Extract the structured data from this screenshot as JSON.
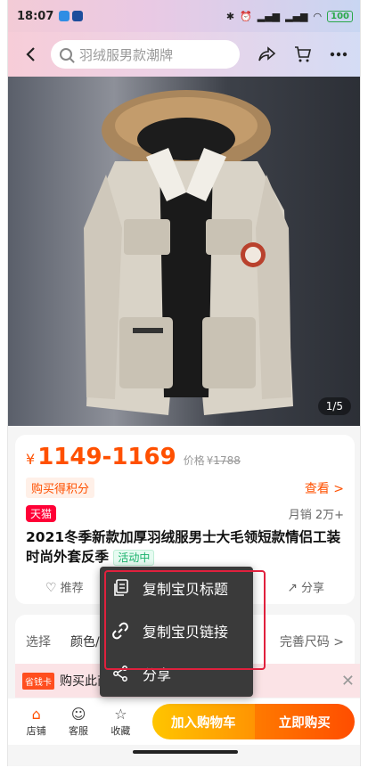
{
  "status_bar": {
    "time": "18:07",
    "battery": "100"
  },
  "nav": {
    "search_placeholder": "羽绒服男款潮牌"
  },
  "gallery": {
    "pager": "1/5"
  },
  "price": {
    "currency": "¥",
    "range": "1149-1169",
    "orig_label": "价格",
    "orig_currency": "¥",
    "orig_value": "1788"
  },
  "points_tag": "购买得积分",
  "see_link": "查看 >",
  "store_tag": "天猫",
  "sales": "月销 2万+",
  "product_title": "2021冬季新款加厚羽绒服男士大毛领短款情侣工装时尚外套反季",
  "active_tag": "活动中",
  "actions": {
    "recommend": "推荐",
    "share": "分享"
  },
  "spec": {
    "label": "选择",
    "value": "颜色/",
    "more": "完善尺码 >"
  },
  "promo": {
    "tag": "省钱卡",
    "text": "购买此商品"
  },
  "bottom_bar": {
    "store": "店铺",
    "service": "客服",
    "favorite": "收藏",
    "add_cart": "加入购物车",
    "buy_now": "立即购买"
  },
  "popup_menu": {
    "items": [
      {
        "label": "复制宝贝标题",
        "icon": "copy-icon"
      },
      {
        "label": "复制宝贝链接",
        "icon": "link-icon"
      },
      {
        "label": "分享",
        "icon": "share-icon"
      }
    ]
  },
  "colors": {
    "accent": "#ff5000",
    "tmall": "#ff0036",
    "highlight": "#e0203d"
  }
}
